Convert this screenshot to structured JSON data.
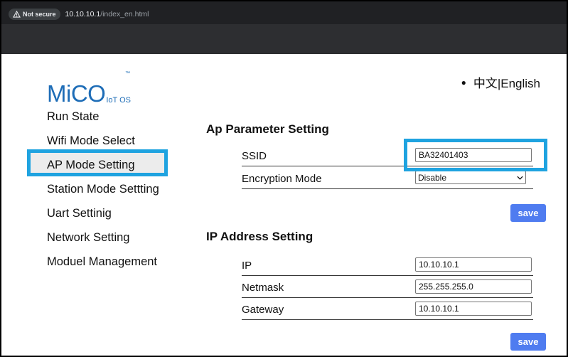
{
  "browser": {
    "security_label": "Not secure",
    "url_host": "10.10.10.1",
    "url_path": "/index_en.html"
  },
  "logo": {
    "main": "MiCO",
    "sub": "IoT OS",
    "tm": "™"
  },
  "language": {
    "chinese": "中文",
    "separator": "|",
    "english": "English"
  },
  "nav": {
    "items": [
      {
        "label": "Run State"
      },
      {
        "label": "Wifi Mode Select"
      },
      {
        "label": "AP Mode Setting"
      },
      {
        "label": "Station Mode Settting"
      },
      {
        "label": "Uart Settinig"
      },
      {
        "label": "Network Setting"
      },
      {
        "label": "Moduel Management"
      }
    ],
    "active_index": 2
  },
  "ap_section": {
    "title": "Ap Parameter Setting",
    "ssid_label": "SSID",
    "ssid_value": "BA32401403",
    "encryption_label": "Encryption Mode",
    "encryption_value": "Disable",
    "save_label": "save"
  },
  "ip_section": {
    "title": "IP Address Setting",
    "ip_label": "IP",
    "ip_value": "10.10.10.1",
    "netmask_label": "Netmask",
    "netmask_value": "255.255.255.0",
    "gateway_label": "Gateway",
    "gateway_value": "10.10.10.1",
    "save_label": "save"
  },
  "colors": {
    "highlight": "#1fa3e0",
    "button": "#4f7cf0",
    "logo": "#1e6db7",
    "browser_bar": "#202124"
  }
}
